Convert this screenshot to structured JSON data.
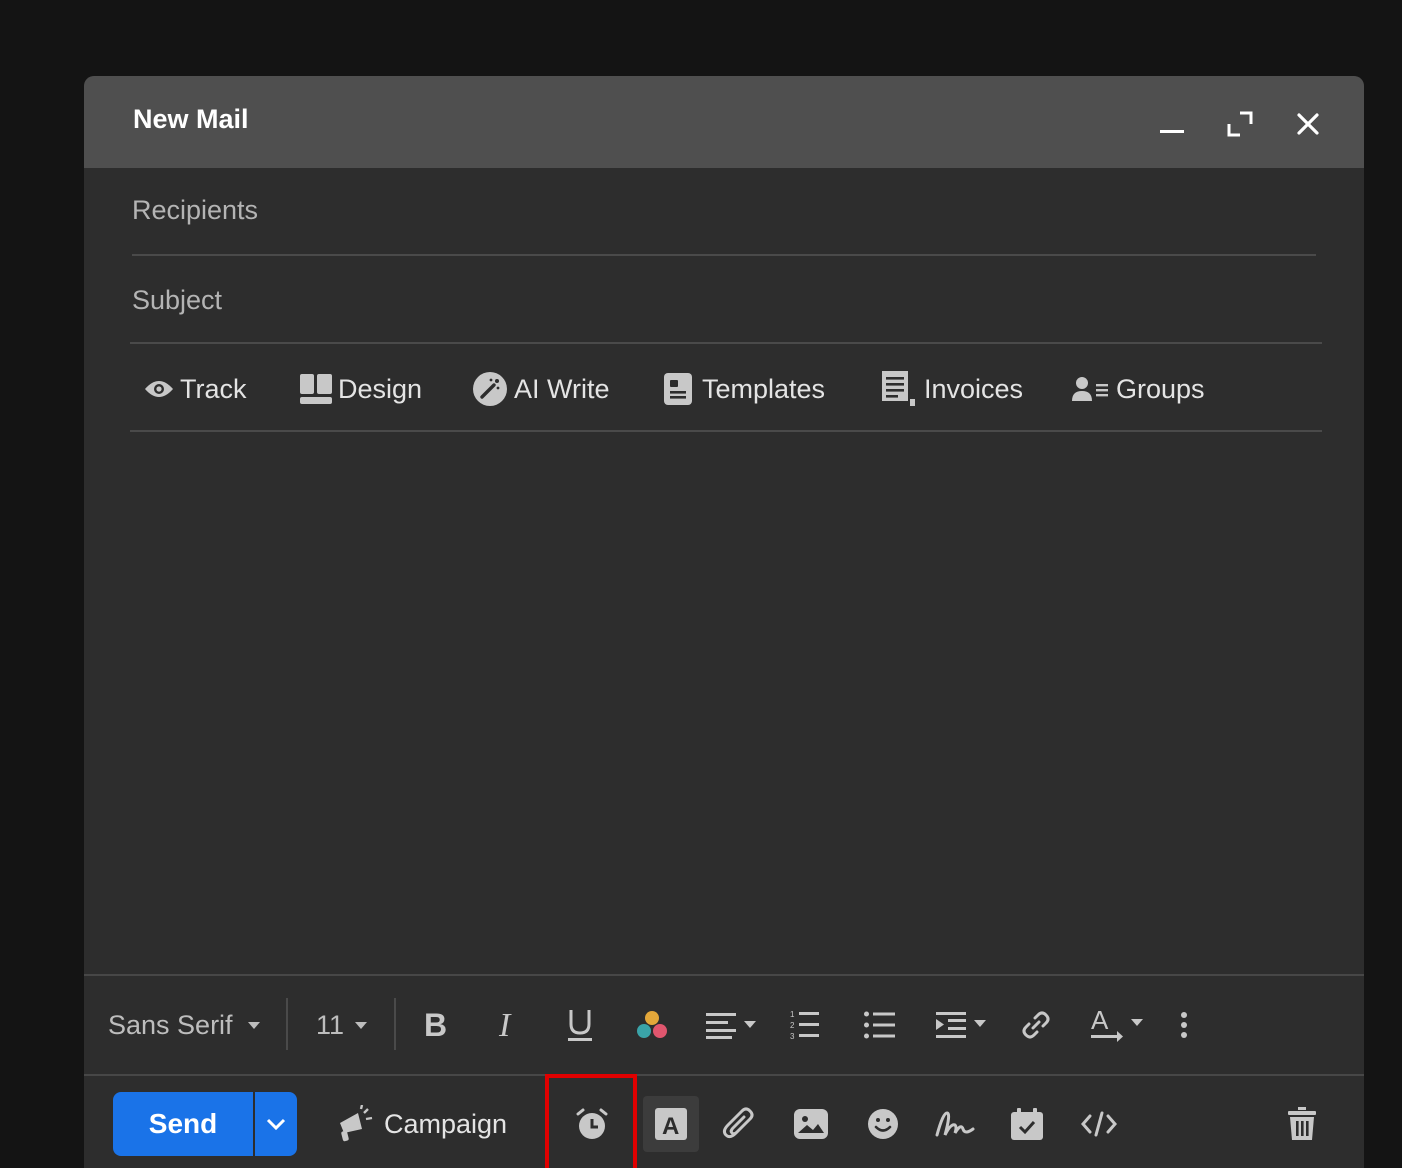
{
  "window": {
    "title": "New Mail",
    "controls": [
      "minimize-icon",
      "expand-icon",
      "close-icon"
    ]
  },
  "fields": {
    "recipients_placeholder": "Recipients",
    "subject_placeholder": "Subject"
  },
  "features": [
    {
      "label": "Track",
      "icon": "eye-icon"
    },
    {
      "label": "Design",
      "icon": "layout-icon"
    },
    {
      "label": "AI Write",
      "icon": "magic-wand-icon"
    },
    {
      "label": "Templates",
      "icon": "template-icon"
    },
    {
      "label": "Invoices",
      "icon": "invoice-icon"
    },
    {
      "label": "Groups",
      "icon": "groups-icon"
    }
  ],
  "format_bar": {
    "font_family": "Sans Serif",
    "font_size": "11"
  },
  "send_bar": {
    "send_label": "Send",
    "campaign_label": "Campaign"
  },
  "colors": {
    "accent": "#1a73e8",
    "highlight": "#e00000",
    "titlebar": "#4f4f4f",
    "panel": "#2d2d2d",
    "backdrop": "#141414"
  }
}
